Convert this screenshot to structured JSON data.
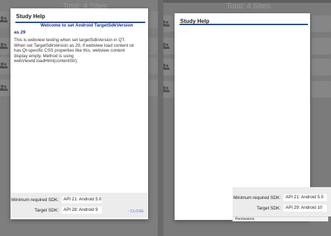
{
  "left": {
    "background_title": "Total: 4 Sites",
    "dialog": {
      "title": "Study Help",
      "welcome": "Welcome to set Android TargetSdkVersion as 29",
      "body": "This is webview testing when set targetSdkVersion in QT.\nWhen set TargetSdkVersion as 29, if webview load content str\nhas Qt-specific CSS properties like this,  webview content\ndisplay empty.  Method is using\nwebViewId.loadHtml(contentStr);"
    },
    "sdk": {
      "min_label": "Minimum required SDK:",
      "min_value": "API 21: Android 5.0",
      "target_label": "Target SDK:",
      "target_value": "API 28: Android 9",
      "close_label": "◦ CLOSE"
    }
  },
  "right": {
    "background_title": "Total: 4 Sites",
    "dialog": {
      "title": "Study Help"
    },
    "sdk": {
      "min_label": "Minimum required SDK:",
      "min_value": "API 21: Android 5.0",
      "target_label": "Target SDK:",
      "target_value": "API 29: Android 10",
      "permissions_label": "Permissions"
    }
  },
  "colors": {
    "title_rule": "#2a4a8a",
    "welcome_text": "#1e2d7a",
    "close_link": "#3b7be0"
  },
  "icons": {
    "site_row": "people-icon"
  }
}
